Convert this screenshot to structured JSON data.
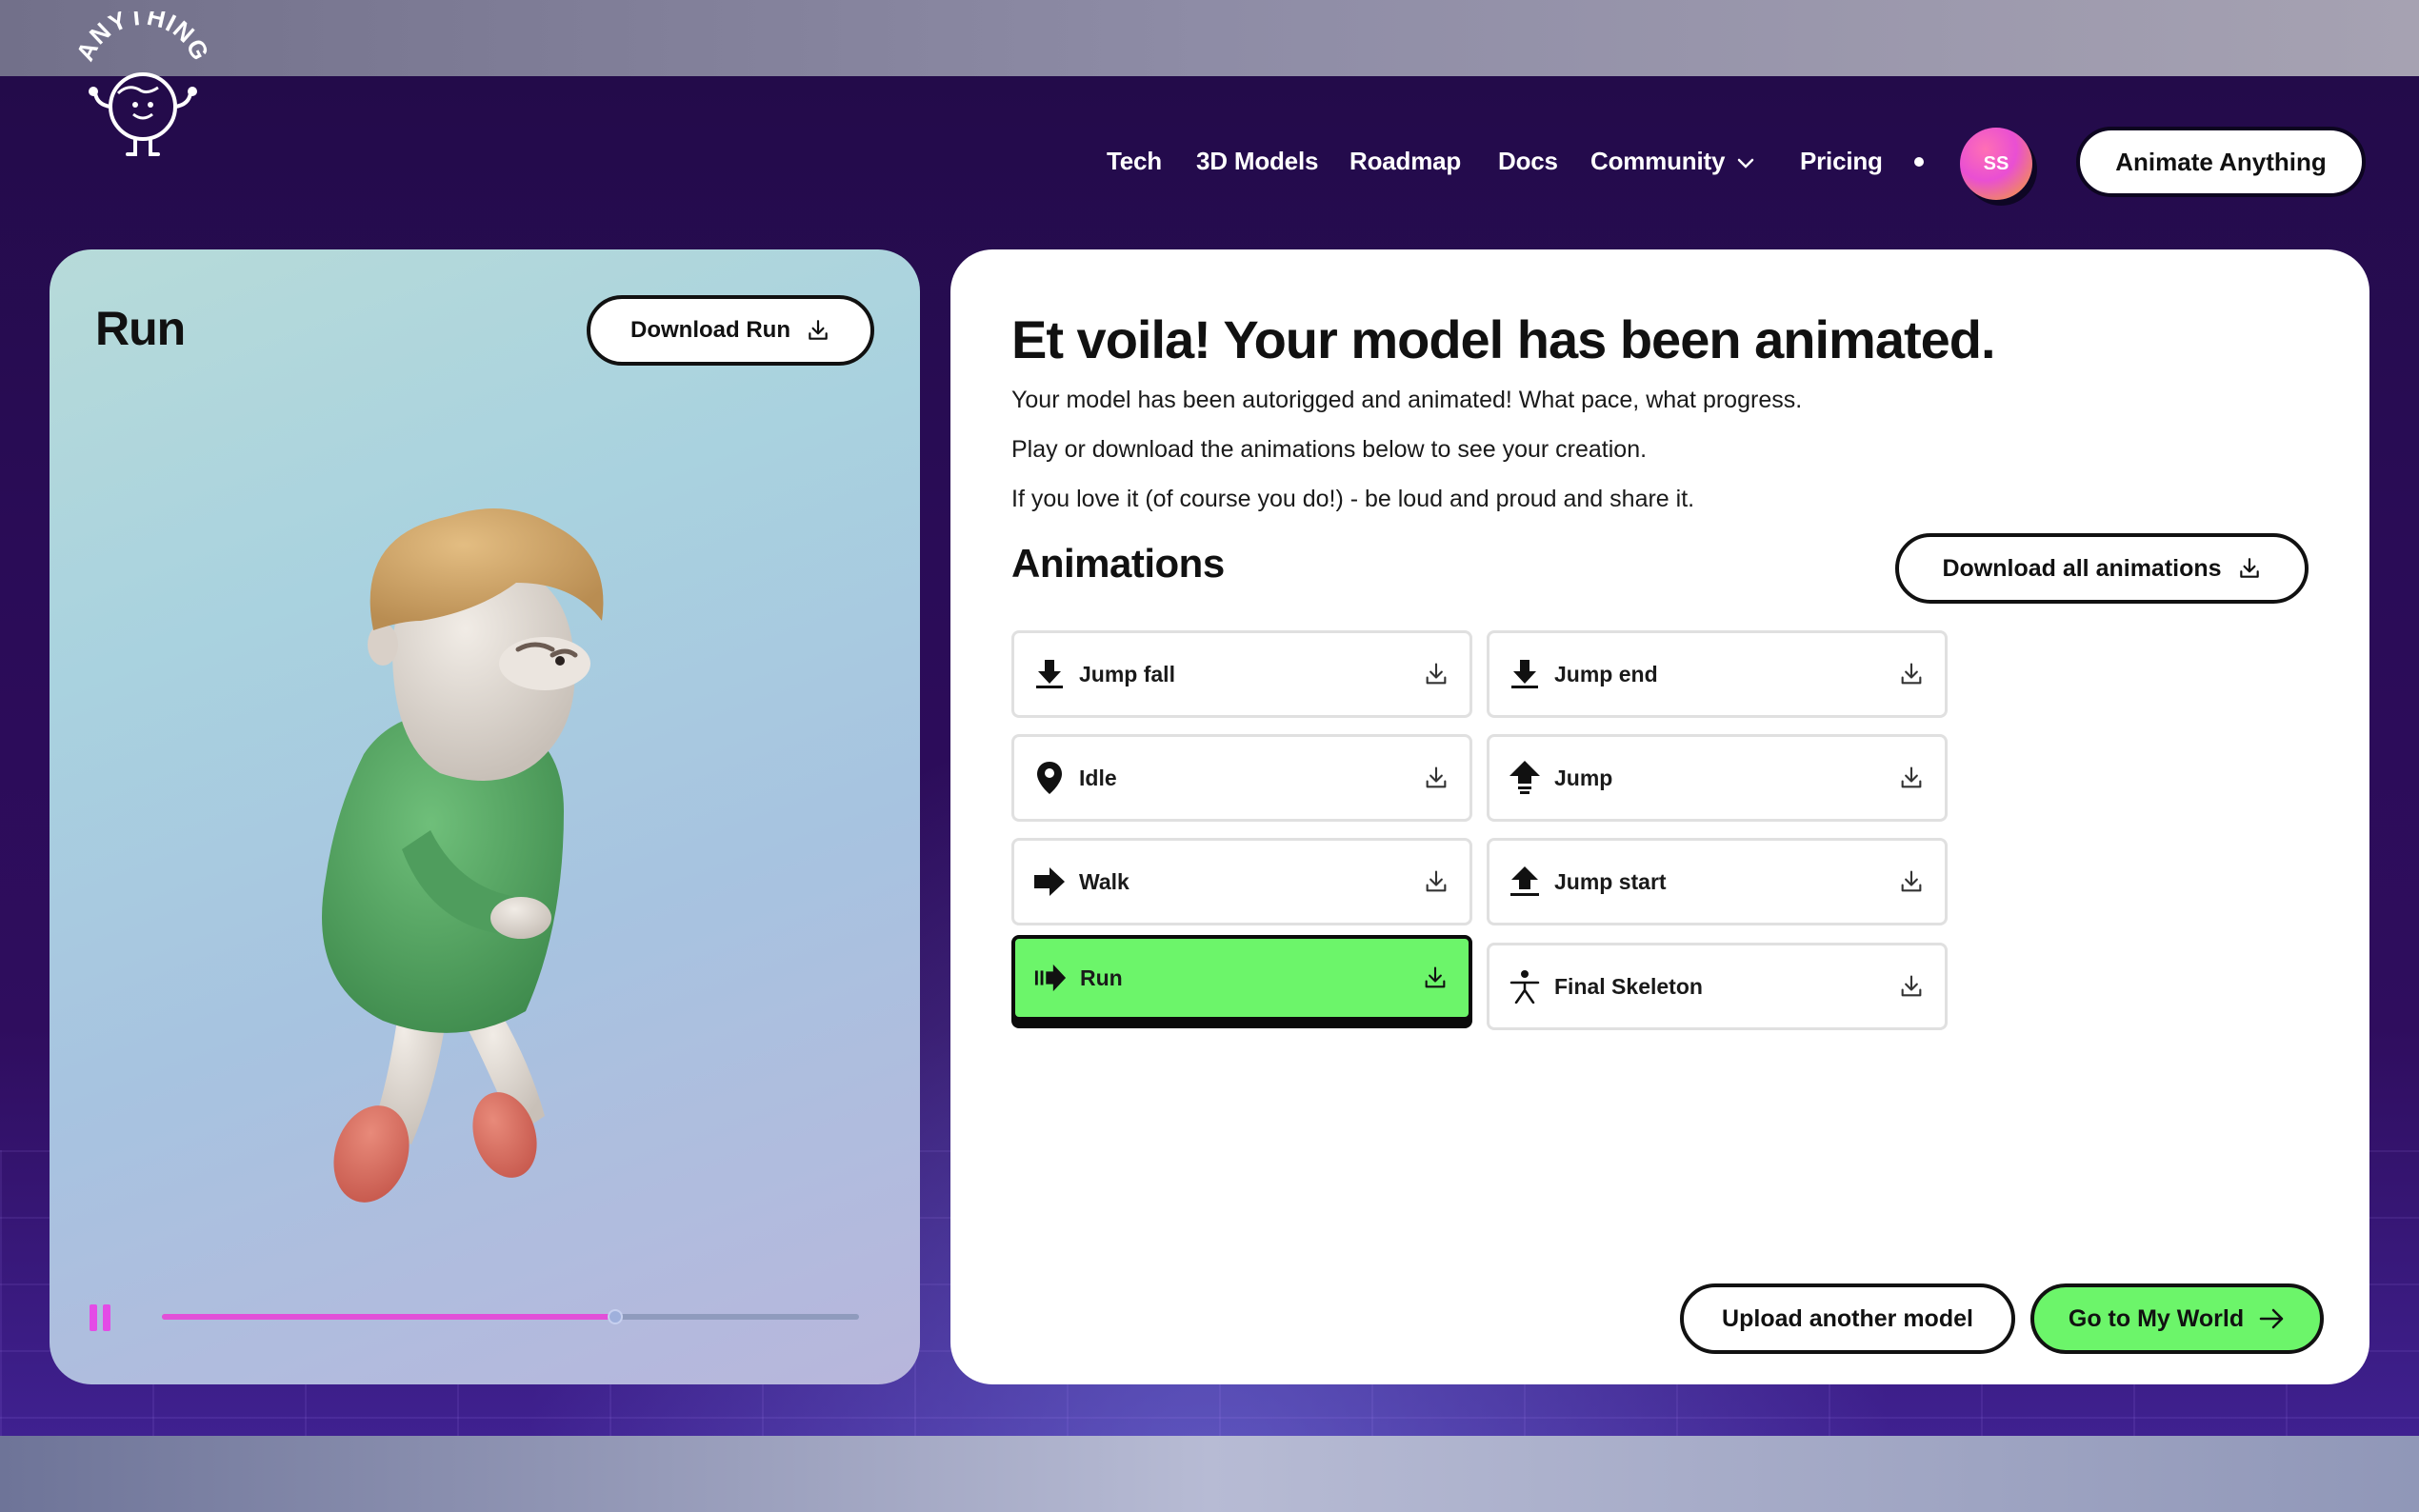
{
  "header": {
    "logo_text": "ANYTHING",
    "nav": {
      "tech": "Tech",
      "models": "3D Models",
      "roadmap": "Roadmap",
      "docs": "Docs",
      "community": "Community",
      "pricing": "Pricing"
    },
    "avatar_initials": "SS",
    "cta_label": "Animate Anything"
  },
  "viewer": {
    "title": "Run",
    "download_label": "Download Run",
    "playback_progress": 0.65,
    "is_playing": true
  },
  "panel": {
    "title": "Et voila! Your model has been animated.",
    "lines": [
      "Your model has been autorigged and animated! What pace, what progress.",
      "Play or download the animations below to see your creation.",
      "If you love it (of course you do!) - be loud and proud and share it."
    ],
    "animations_heading": "Animations",
    "download_all_label": "Download all animations",
    "animations": [
      {
        "label": "Jump fall",
        "icon": "arrow-down-to-line-icon",
        "active": false
      },
      {
        "label": "Jump end",
        "icon": "arrow-down-to-line-icon",
        "active": false
      },
      {
        "label": "Idle",
        "icon": "map-pin-icon",
        "active": false
      },
      {
        "label": "Jump",
        "icon": "arrow-up-icon",
        "active": false
      },
      {
        "label": "Walk",
        "icon": "arrow-right-icon",
        "active": false
      },
      {
        "label": "Jump start",
        "icon": "arrow-up-from-line-icon",
        "active": false
      },
      {
        "label": "Run",
        "icon": "fast-forward-arrow-icon",
        "active": true
      },
      {
        "label": "Final Skeleton",
        "icon": "skeleton-figure-icon",
        "active": false
      }
    ],
    "upload_label": "Upload another model",
    "world_label": "Go to My World"
  },
  "colors": {
    "accent_green": "#6cf56a",
    "accent_pink": "#e24fd8",
    "background_purple": "#2a0c57"
  }
}
